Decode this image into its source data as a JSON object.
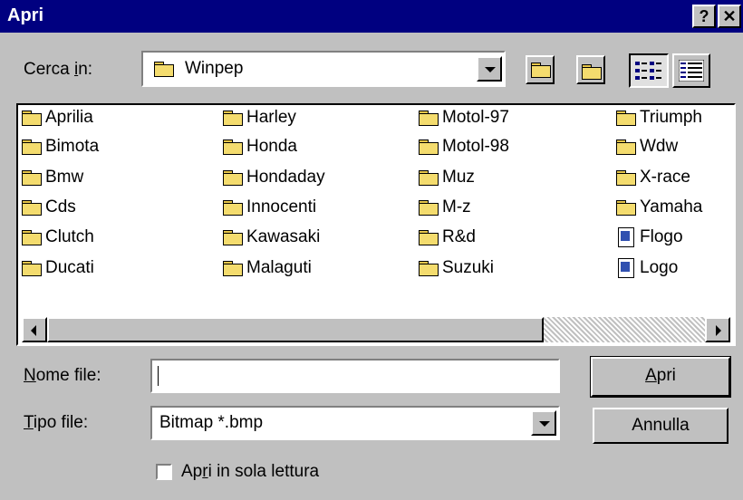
{
  "window": {
    "title": "Apri",
    "help_glyph": "?",
    "close_glyph": "✕"
  },
  "lookin": {
    "label_pre": "Cerca ",
    "label_key": "i",
    "label_post": "n:",
    "value": "Winpep"
  },
  "icons": [
    "up-folder-icon",
    "new-folder-icon",
    "list-view-icon",
    "details-view-icon"
  ],
  "files": {
    "columns": [
      [
        {
          "name": "Aprilia",
          "type": "folder"
        },
        {
          "name": "Bimota",
          "type": "folder"
        },
        {
          "name": "Bmw",
          "type": "folder"
        },
        {
          "name": "Cds",
          "type": "folder"
        },
        {
          "name": "Clutch",
          "type": "folder"
        },
        {
          "name": "Ducati",
          "type": "folder"
        }
      ],
      [
        {
          "name": "Harley",
          "type": "folder"
        },
        {
          "name": "Honda",
          "type": "folder"
        },
        {
          "name": "Hondaday",
          "type": "folder"
        },
        {
          "name": "Innocenti",
          "type": "folder"
        },
        {
          "name": "Kawasaki",
          "type": "folder"
        },
        {
          "name": "Malaguti",
          "type": "folder"
        }
      ],
      [
        {
          "name": "Motol-97",
          "type": "folder"
        },
        {
          "name": "Motol-98",
          "type": "folder"
        },
        {
          "name": "Muz",
          "type": "folder"
        },
        {
          "name": "M-z",
          "type": "folder"
        },
        {
          "name": "R&d",
          "type": "folder"
        },
        {
          "name": "Suzuki",
          "type": "folder"
        }
      ],
      [
        {
          "name": "Triumph",
          "type": "folder"
        },
        {
          "name": "Wdw",
          "type": "folder"
        },
        {
          "name": "X-race",
          "type": "folder"
        },
        {
          "name": "Yamaha",
          "type": "folder"
        },
        {
          "name": "Flogo",
          "type": "bitmap"
        },
        {
          "name": "Logo",
          "type": "bitmap"
        }
      ]
    ]
  },
  "filename": {
    "label_key": "N",
    "label_rest": "ome file:",
    "value": ""
  },
  "filetype": {
    "label_key": "T",
    "label_rest": "ipo file:",
    "value": "Bitmap *.bmp"
  },
  "readonly": {
    "label_pre": "Ap",
    "label_key": "r",
    "label_post": "i in sola lettura",
    "checked": false
  },
  "buttons": {
    "open_key": "A",
    "open_rest": "pri",
    "cancel": "Annulla"
  },
  "colors": {
    "titlebar": "#000080",
    "face": "#c0c0c0"
  }
}
